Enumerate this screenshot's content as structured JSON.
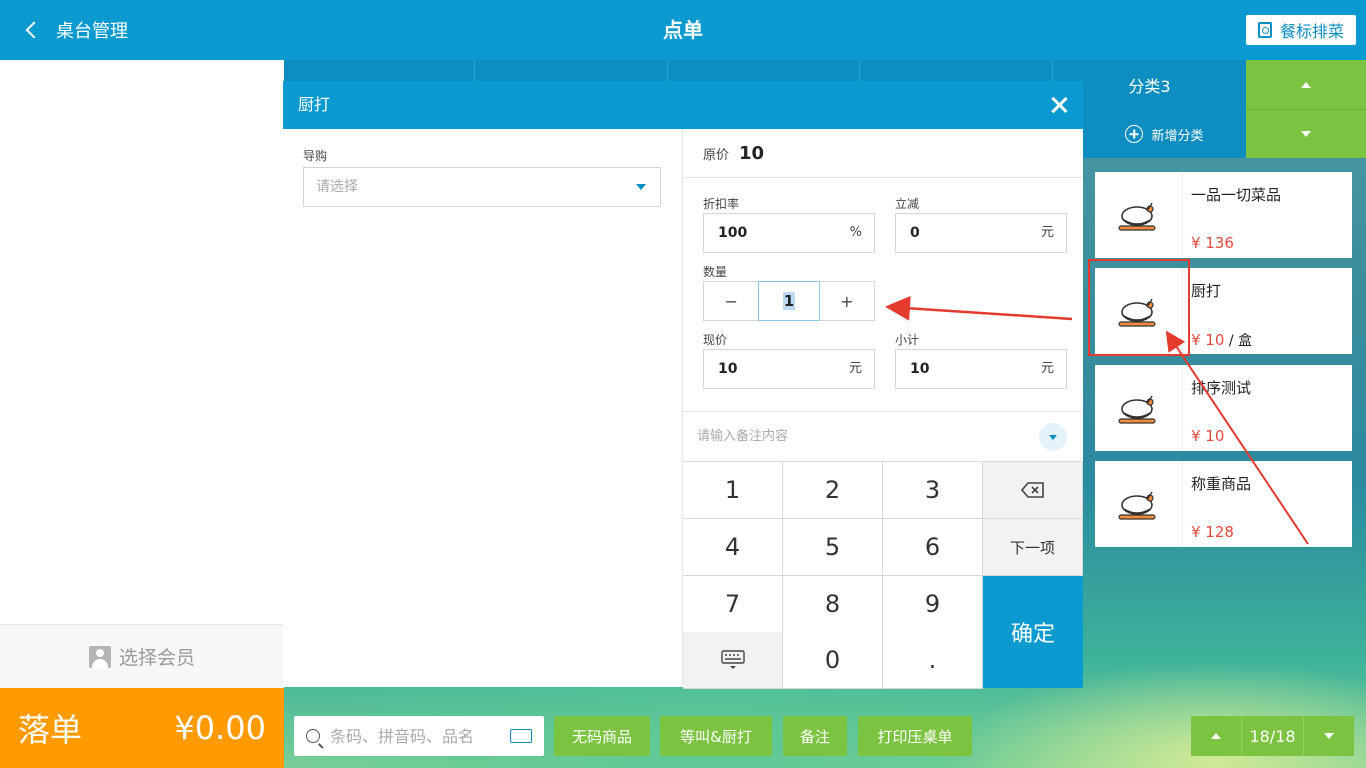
{
  "header": {
    "back_label": "桌台管理",
    "title": "点单",
    "right_button": "餐标排菜"
  },
  "left_panel": {
    "member_label": "选择会员",
    "order_label": "落单",
    "order_amount": "¥0.00"
  },
  "categories": {
    "items": [
      "",
      "",
      "",
      "",
      "分类3"
    ],
    "new_category": "新增分类"
  },
  "products": [
    {
      "name": "一品一切菜品",
      "price": "¥ 136",
      "unit": ""
    },
    {
      "name": "厨打",
      "price": "¥ 10",
      "unit": " / 盒"
    },
    {
      "name": "排序测试",
      "price": "¥ 10",
      "unit": ""
    },
    {
      "name": "称重商品",
      "price": "¥ 128",
      "unit": ""
    }
  ],
  "modal": {
    "title": "厨打",
    "guide_label": "导购",
    "guide_placeholder": "请选择",
    "orig_label": "原价",
    "orig_value": "10",
    "discount_label": "折扣率",
    "discount_value": "100",
    "discount_suffix": "%",
    "reduce_label": "立减",
    "reduce_value": "0",
    "reduce_suffix": "元",
    "qty_label": "数量",
    "qty_value": "1",
    "qty_minus": "−",
    "qty_plus": "+",
    "now_label": "现价",
    "now_value": "10",
    "now_suffix": "元",
    "subtotal_label": "小计",
    "subtotal_value": "10",
    "subtotal_suffix": "元",
    "remark_placeholder": "请输入备注内容",
    "keys": [
      "1",
      "2",
      "3",
      "4",
      "5",
      "6",
      "7",
      "8",
      "9",
      "0",
      "."
    ],
    "next_label": "下一项",
    "confirm_label": "确定"
  },
  "toolbar": {
    "search_placeholder": "条码、拼音码、品名",
    "btn_no_code": "无码商品",
    "btn_wait": "等叫&厨打",
    "btn_remark": "备注",
    "btn_print": "打印压桌单",
    "page": "18/18"
  },
  "colors": {
    "primary": "#0a9ad0",
    "green": "#7cc341",
    "orange": "#ff9a00",
    "price_red": "#e84a3c",
    "annotation_red": "#e53a2e"
  }
}
